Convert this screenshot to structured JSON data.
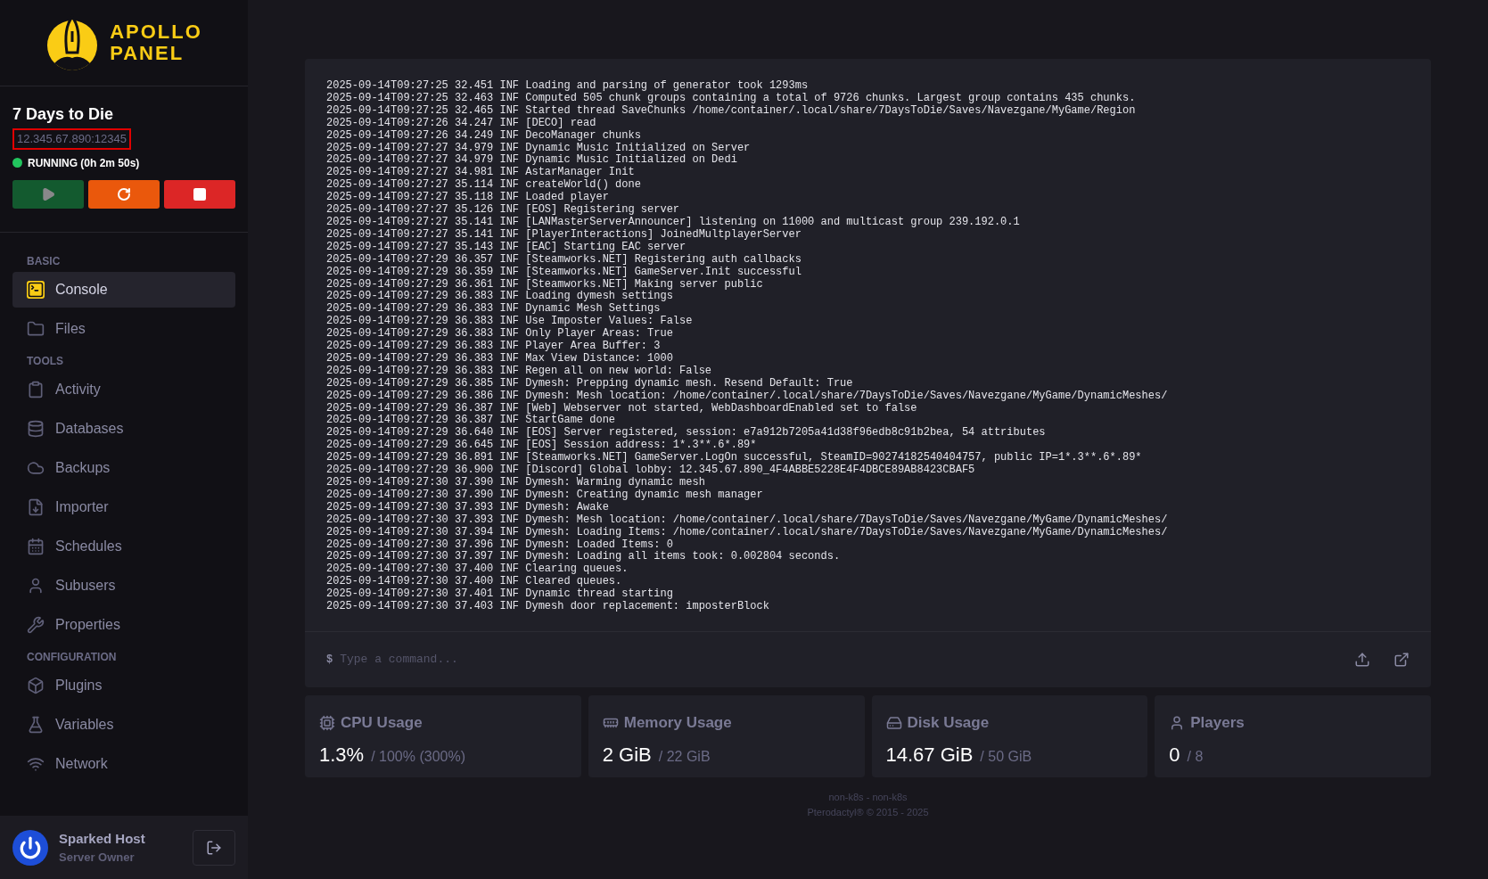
{
  "logo": {
    "lines": [
      "APOLLO",
      "PANEL"
    ]
  },
  "server": {
    "name": "7 Days to Die",
    "address": "12.345.67.890:12345",
    "running": true,
    "status_text": "RUNNING (0h 2m 50s)"
  },
  "controls": [
    {
      "kind": "start",
      "disabled": true
    },
    {
      "kind": "restart",
      "disabled": false
    },
    {
      "kind": "stop",
      "disabled": false
    }
  ],
  "sidebar": {
    "sections": [
      {
        "title": "BASIC",
        "items": [
          {
            "label": "Console",
            "selected": true
          },
          {
            "label": "Files",
            "selected": false
          }
        ]
      },
      {
        "title": "TOOLS",
        "items": [
          {
            "label": "Activity",
            "selected": false
          },
          {
            "label": "Databases",
            "selected": false
          },
          {
            "label": "Backups",
            "selected": false
          },
          {
            "label": "Importer",
            "selected": false
          },
          {
            "label": "Schedules",
            "selected": false
          },
          {
            "label": "Subusers",
            "selected": false
          },
          {
            "label": "Properties",
            "selected": false
          }
        ]
      },
      {
        "title": "CONFIGURATION",
        "items": [
          {
            "label": "Plugins",
            "selected": false
          },
          {
            "label": "Variables",
            "selected": false
          },
          {
            "label": "Network",
            "selected": false
          }
        ]
      }
    ]
  },
  "user": {
    "name": "Sparked Host",
    "role": "Server Owner"
  },
  "console": {
    "lines": [
      "2025-09-14T09:27:25 32.451 INF Loading and parsing of generator took 1293ms",
      "2025-09-14T09:27:25 32.463 INF Computed 505 chunk groups containing a total of 9726 chunks. Largest group contains 435 chunks.",
      "2025-09-14T09:27:25 32.465 INF Started thread SaveChunks /home/container/.local/share/7DaysToDie/Saves/Navezgane/MyGame/Region",
      "2025-09-14T09:27:26 34.247 INF [DECO] read",
      "2025-09-14T09:27:26 34.249 INF DecoManager chunks",
      "2025-09-14T09:27:27 34.979 INF Dynamic Music Initialized on Server",
      "2025-09-14T09:27:27 34.979 INF Dynamic Music Initialized on Dedi",
      "2025-09-14T09:27:27 34.981 INF AstarManager Init",
      "2025-09-14T09:27:27 35.114 INF createWorld() done",
      "2025-09-14T09:27:27 35.118 INF Loaded player",
      "2025-09-14T09:27:27 35.126 INF [EOS] Registering server",
      "2025-09-14T09:27:27 35.141 INF [LANMasterServerAnnouncer] listening on 11000 and multicast group 239.192.0.1",
      "2025-09-14T09:27:27 35.141 INF [PlayerInteractions] JoinedMultplayerServer",
      "2025-09-14T09:27:27 35.143 INF [EAC] Starting EAC server",
      "2025-09-14T09:27:29 36.357 INF [Steamworks.NET] Registering auth callbacks",
      "2025-09-14T09:27:29 36.359 INF [Steamworks.NET] GameServer.Init successful",
      "2025-09-14T09:27:29 36.361 INF [Steamworks.NET] Making server public",
      "2025-09-14T09:27:29 36.383 INF Loading dymesh settings",
      "2025-09-14T09:27:29 36.383 INF Dynamic Mesh Settings",
      "2025-09-14T09:27:29 36.383 INF Use Imposter Values: False",
      "2025-09-14T09:27:29 36.383 INF Only Player Areas: True",
      "2025-09-14T09:27:29 36.383 INF Player Area Buffer: 3",
      "2025-09-14T09:27:29 36.383 INF Max View Distance: 1000",
      "2025-09-14T09:27:29 36.383 INF Regen all on new world: False",
      "2025-09-14T09:27:29 36.385 INF Dymesh: Prepping dynamic mesh. Resend Default: True",
      "2025-09-14T09:27:29 36.386 INF Dymesh: Mesh location: /home/container/.local/share/7DaysToDie/Saves/Navezgane/MyGame/DynamicMeshes/",
      "2025-09-14T09:27:29 36.387 INF [Web] Webserver not started, WebDashboardEnabled set to false",
      "2025-09-14T09:27:29 36.387 INF StartGame done",
      "2025-09-14T09:27:29 36.640 INF [EOS] Server registered, session: e7a912b7205a41d38f96edb8c91b2bea, 54 attributes",
      "2025-09-14T09:27:29 36.645 INF [EOS] Session address: 1*.3**.6*.89*",
      "2025-09-14T09:27:29 36.891 INF [Steamworks.NET] GameServer.LogOn successful, SteamID=90274182540404757, public IP=1*.3**.6*.89*",
      "2025-09-14T09:27:29 36.900 INF [Discord] Global lobby: 12.345.67.890_4F4ABBE5228E4F4DBCE89AB8423CBAF5",
      "2025-09-14T09:27:30 37.390 INF Dymesh: Warming dynamic mesh",
      "2025-09-14T09:27:30 37.390 INF Dymesh: Creating dynamic mesh manager",
      "2025-09-14T09:27:30 37.393 INF Dymesh: Awake",
      "2025-09-14T09:27:30 37.393 INF Dymesh: Mesh location: /home/container/.local/share/7DaysToDie/Saves/Navezgane/MyGame/DynamicMeshes/",
      "2025-09-14T09:27:30 37.394 INF Dymesh: Loading Items: /home/container/.local/share/7DaysToDie/Saves/Navezgane/MyGame/DynamicMeshes/",
      "2025-09-14T09:27:30 37.396 INF Dymesh: Loaded Items: 0",
      "2025-09-14T09:27:30 37.397 INF Dymesh: Loading all items took: 0.002804 seconds.",
      "2025-09-14T09:27:30 37.400 INF Clearing queues.",
      "2025-09-14T09:27:30 37.400 INF Cleared queues.",
      "2025-09-14T09:27:30 37.401 INF Dynamic thread starting",
      "2025-09-14T09:27:30 37.403 INF Dymesh door replacement: imposterBlock"
    ],
    "prompt": "$",
    "placeholder": "Type a command..."
  },
  "stats": [
    {
      "label": "CPU Usage",
      "value": "1.3%",
      "limit": "/ 100% (300%)"
    },
    {
      "label": "Memory Usage",
      "value": "2 GiB",
      "limit": "/ 22 GiB"
    },
    {
      "label": "Disk Usage",
      "value": "14.67 GiB",
      "limit": "/ 50 GiB"
    },
    {
      "label": "Players",
      "value": "0",
      "limit": "/ 8"
    }
  ],
  "footer": [
    "non-k8s - non-k8s",
    "Pterodactyl® © 2015 - 2025"
  ]
}
